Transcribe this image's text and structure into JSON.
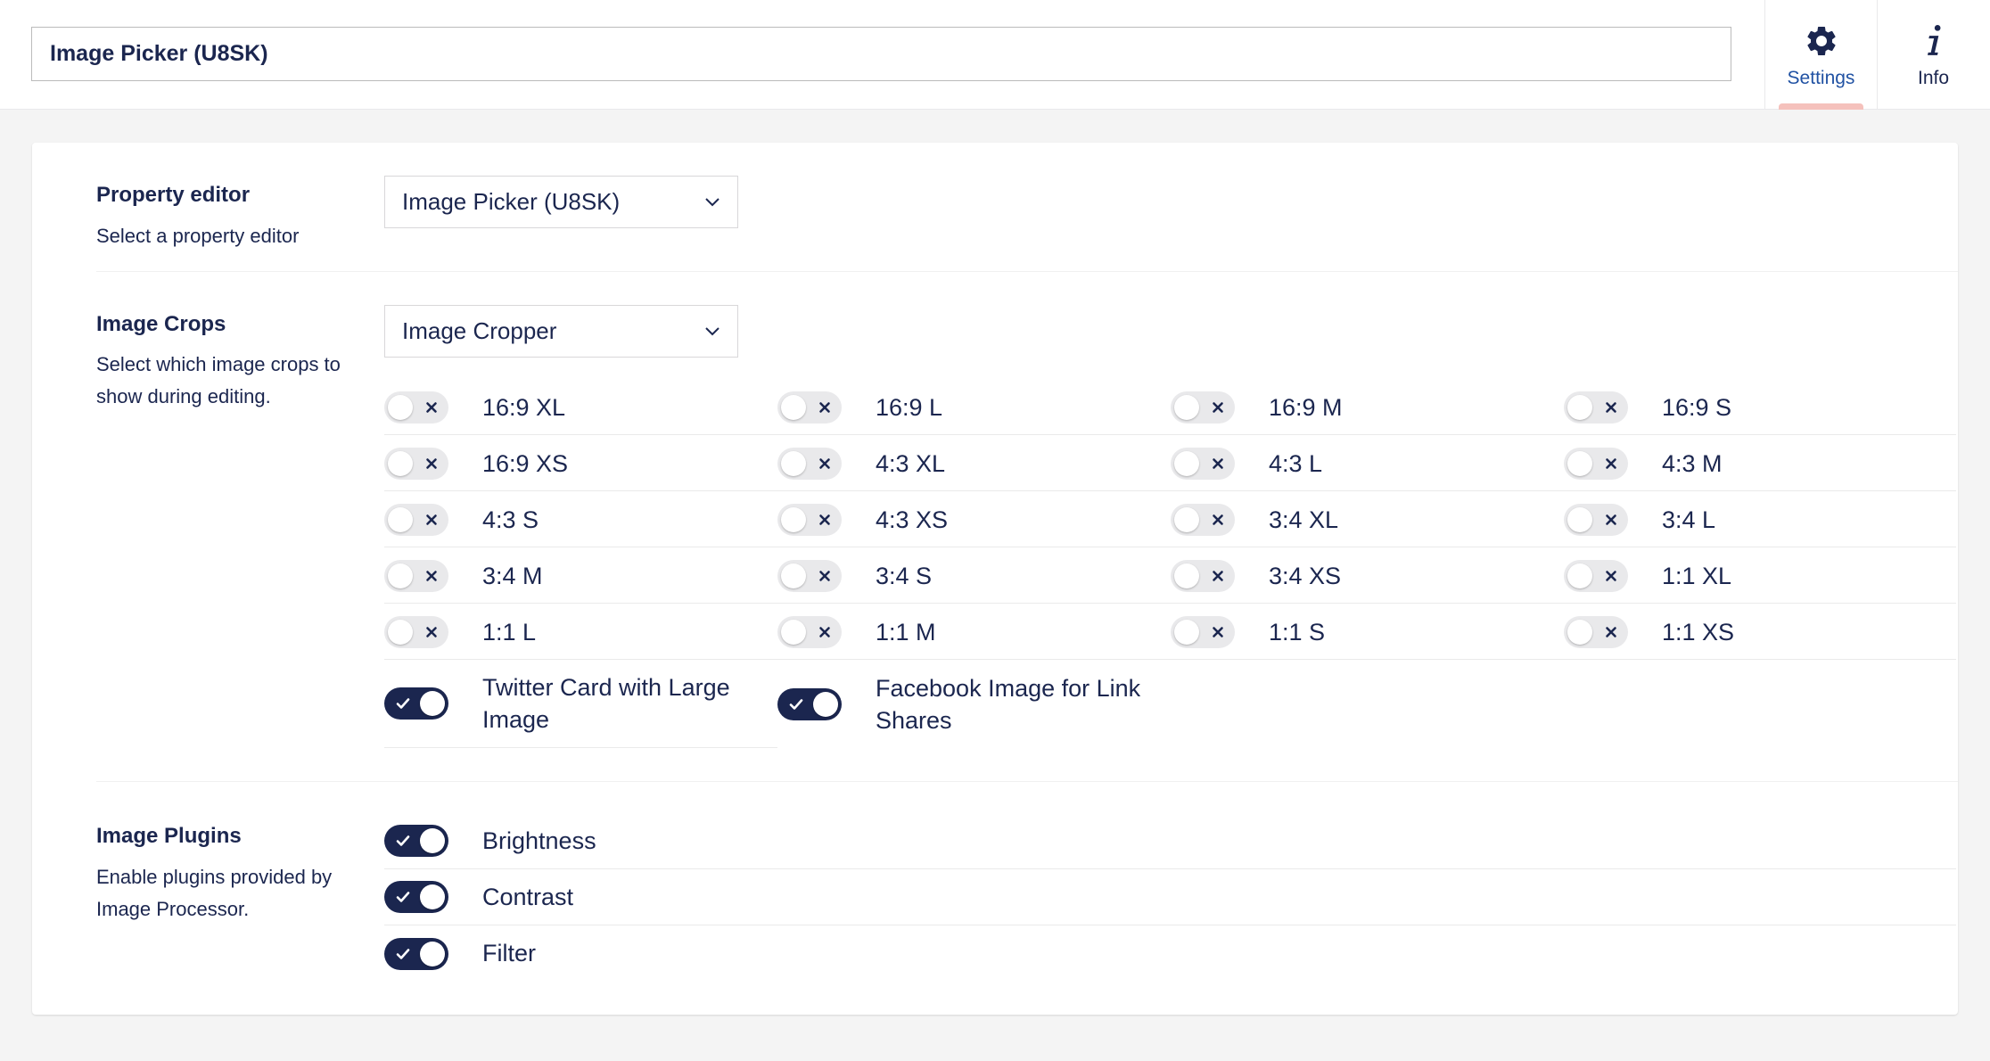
{
  "header": {
    "name_value": "Image Picker (U8SK)",
    "apps": [
      {
        "label": "Settings",
        "icon": "gear-icon",
        "active": true
      },
      {
        "label": "Info",
        "icon": "info-icon",
        "active": false
      }
    ]
  },
  "property_editor": {
    "title": "Property editor",
    "description": "Select a property editor",
    "selected": "Image Picker (U8SK)"
  },
  "image_crops": {
    "title": "Image Crops",
    "description": "Select which image crops to show during editing.",
    "selected": "Image Cropper",
    "crops": [
      {
        "label": "16:9 XL",
        "on": false
      },
      {
        "label": "16:9 L",
        "on": false
      },
      {
        "label": "16:9 M",
        "on": false
      },
      {
        "label": "16:9 S",
        "on": false
      },
      {
        "label": "16:9 XS",
        "on": false
      },
      {
        "label": "4:3 XL",
        "on": false
      },
      {
        "label": "4:3 L",
        "on": false
      },
      {
        "label": "4:3 M",
        "on": false
      },
      {
        "label": "4:3 S",
        "on": false
      },
      {
        "label": "4:3 XS",
        "on": false
      },
      {
        "label": "3:4 XL",
        "on": false
      },
      {
        "label": "3:4 L",
        "on": false
      },
      {
        "label": "3:4 M",
        "on": false
      },
      {
        "label": "3:4 S",
        "on": false
      },
      {
        "label": "3:4 XS",
        "on": false
      },
      {
        "label": "1:1 XL",
        "on": false
      },
      {
        "label": "1:1 L",
        "on": false
      },
      {
        "label": "1:1 M",
        "on": false
      },
      {
        "label": "1:1 S",
        "on": false
      },
      {
        "label": "1:1 XS",
        "on": false
      },
      {
        "label": "Twitter Card with Large Image",
        "on": true
      },
      {
        "label": "Facebook Image for Link Shares",
        "on": true
      }
    ]
  },
  "image_plugins": {
    "title": "Image Plugins",
    "description": "Enable plugins provided by Image Processor.",
    "plugins": [
      {
        "label": "Brightness",
        "on": true
      },
      {
        "label": "Contrast",
        "on": true
      },
      {
        "label": "Filter",
        "on": true
      }
    ]
  },
  "colors": {
    "primary": "#1b264f",
    "toggle_off": "#e9e9eb",
    "active_indicator": "#f5c1bc",
    "settings_label": "#2152a3"
  }
}
